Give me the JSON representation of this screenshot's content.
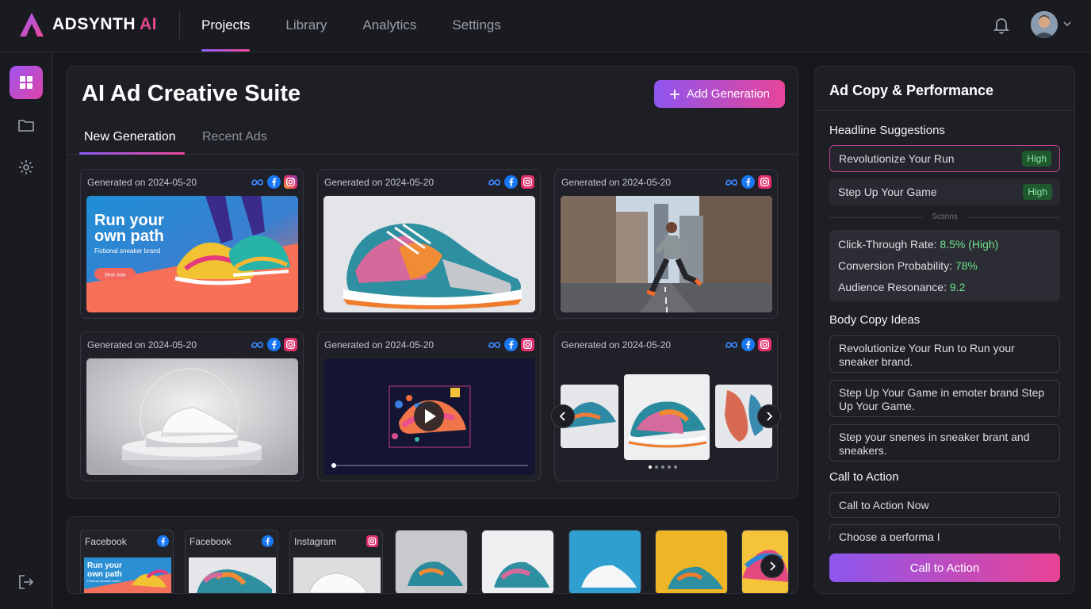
{
  "app": {
    "brand": "ADSYNTH",
    "brand_accent": "AI"
  },
  "nav": {
    "items": [
      "Projects",
      "Library",
      "Analytics",
      "Settings"
    ],
    "active": "Projects"
  },
  "panel": {
    "title": "AI Ad Creative Suite",
    "add_label": "Add Generation",
    "tabs": [
      "New Generation",
      "Recent Ads"
    ]
  },
  "cards": [
    {
      "date": "Generated on 2024-05-20",
      "image": "sneaker-banner-ad"
    },
    {
      "date": "Generated on 2024-05-20",
      "image": "colorful-sneaker-photo"
    },
    {
      "date": "Generated on 2024-05-20",
      "image": "runner-city-street"
    },
    {
      "date": "Generated on 2024-05-20",
      "image": "white-sneaker-pedestal"
    },
    {
      "date": "Generated on 2024-05-20",
      "image": "video-ad-player"
    },
    {
      "date": "Generated on 2024-05-20",
      "image": "sneaker-carousel"
    }
  ],
  "banner": {
    "headline_1": "Run your",
    "headline_2": "own path",
    "sub": "Fictional sneaker brand",
    "button": "Shot now"
  },
  "strip": {
    "items": [
      {
        "label": "Facebook",
        "network": "facebook"
      },
      {
        "label": "Facebook",
        "network": "facebook"
      },
      {
        "label": "Instagram",
        "network": "instagram"
      }
    ],
    "mini_headline_1": "Run your",
    "mini_headline_2": "own path",
    "mini_sub": "Fictional sneaker brand"
  },
  "right": {
    "title": "Ad Copy & Performance",
    "headline_section": "Headline Suggestions",
    "suggestions": [
      {
        "text": "Revolutionize Your Run",
        "badge": "High"
      },
      {
        "text": "Step Up Your Game",
        "badge": "High"
      }
    ],
    "divider": "Scsnns",
    "metrics": [
      {
        "label": "Click-Through Rate:",
        "value": "8.5% (High)"
      },
      {
        "label": "Conversion Probability:",
        "value": "78%"
      },
      {
        "label": "Audience Resonance:",
        "value": "9.2"
      }
    ],
    "body_section": "Body Copy Ideas",
    "body_ideas": [
      "Revolutionize Your Run to Run your sneaker brand.",
      "Step Up Your Game in emoter brand Step Up Your Game.",
      "Step your snenes in sneaker brant and sneakers."
    ],
    "cta_section": "Call to Action",
    "cta_options": [
      "Call to Action Now",
      "Choose a performa I"
    ],
    "cta_button": "Call to Action"
  },
  "colors": {
    "accent_purple": "#8b5cf6",
    "accent_pink": "#ec4899",
    "positive": "#6ee08e"
  }
}
